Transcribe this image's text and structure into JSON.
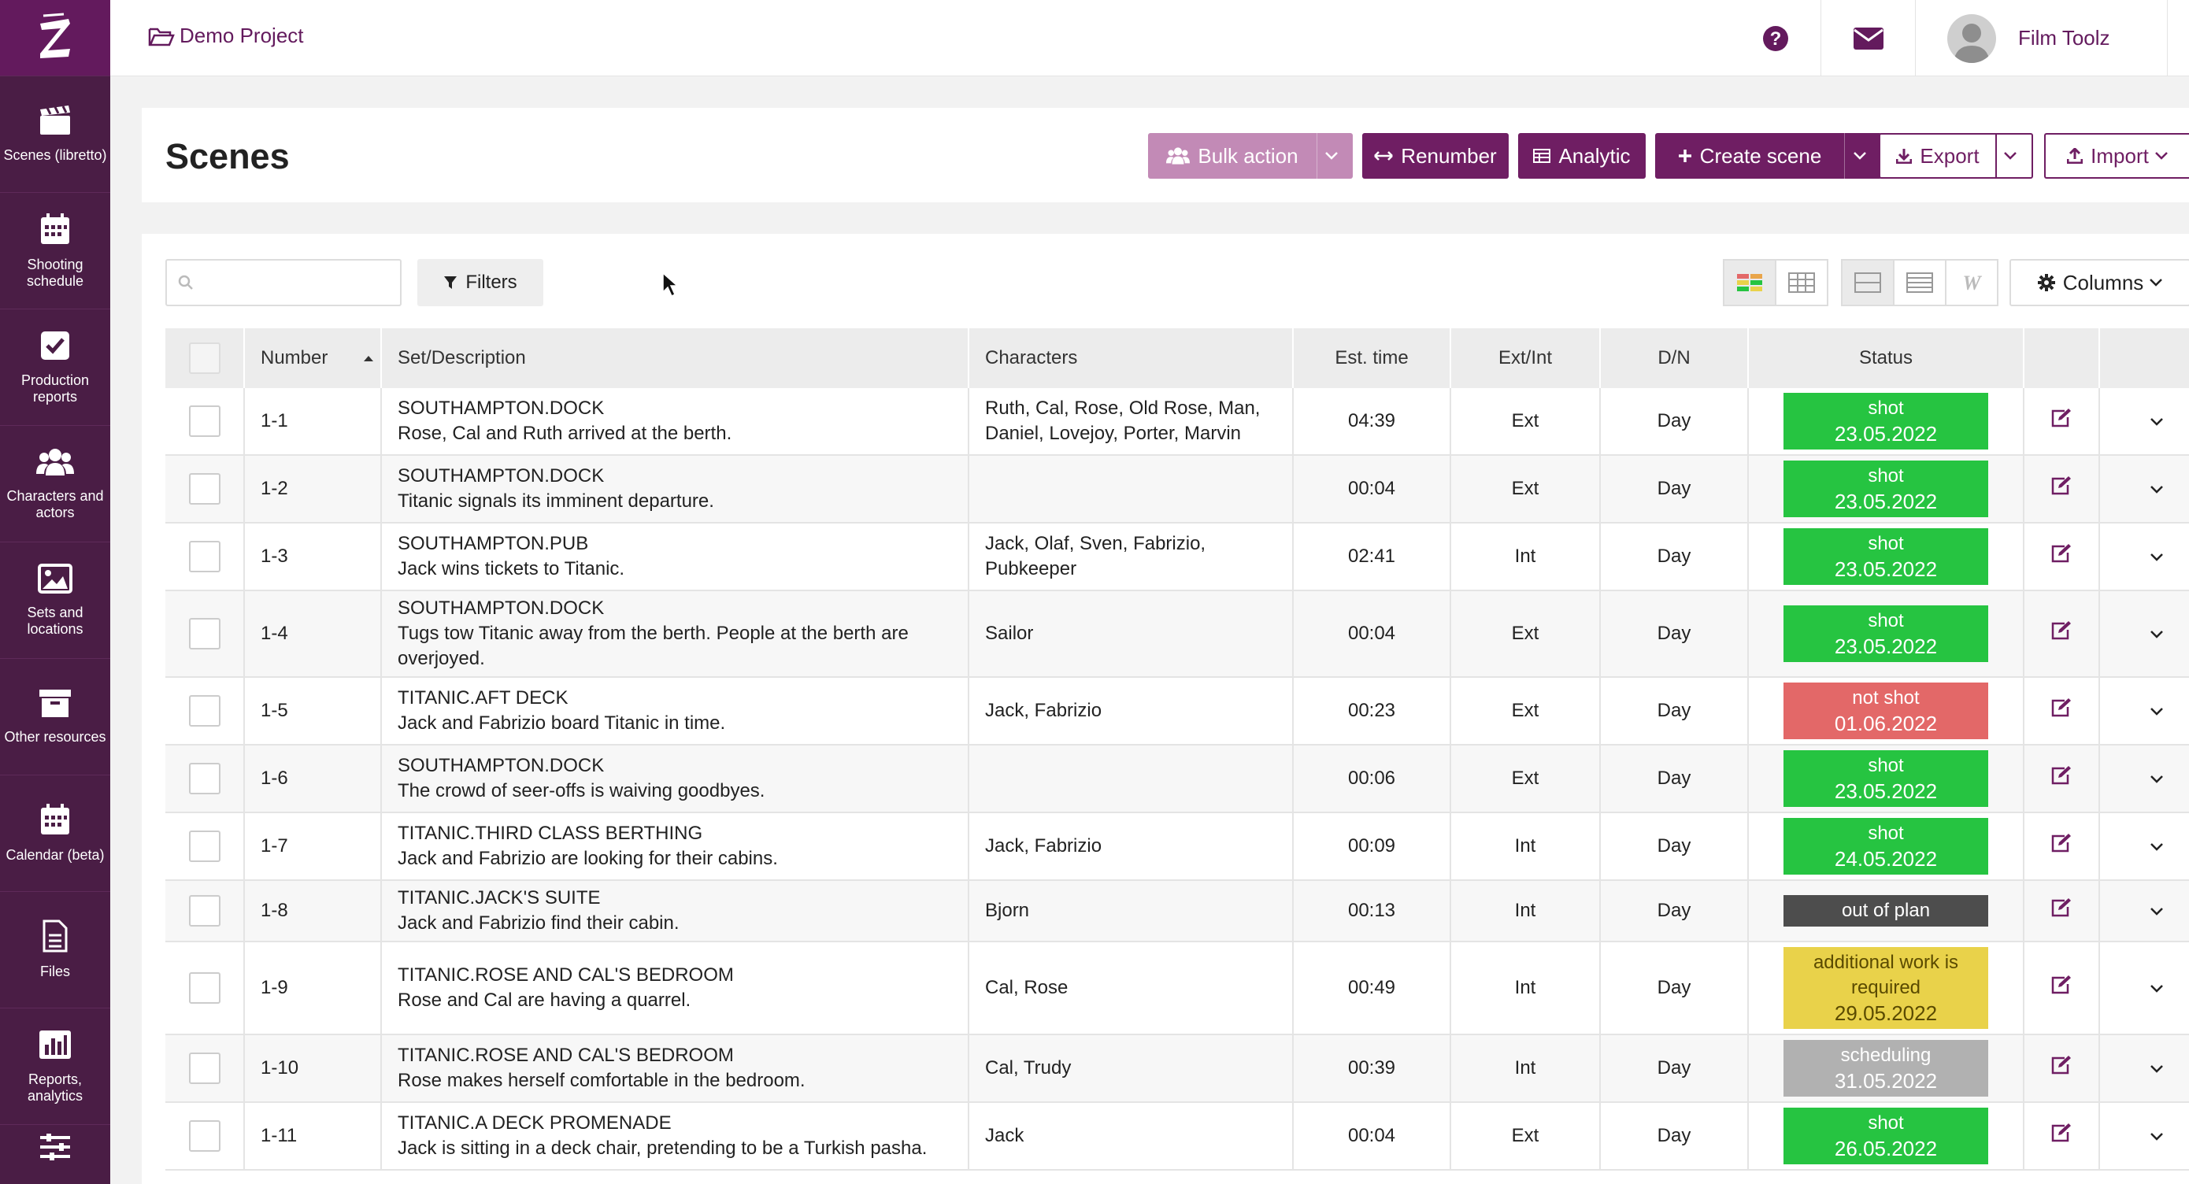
{
  "sidebar": {
    "logo": "Z",
    "items": [
      {
        "label": "Scenes (libretto)",
        "icon": "clapperboard-icon"
      },
      {
        "label": "Shooting schedule",
        "icon": "calendar-icon"
      },
      {
        "label": "Production reports",
        "icon": "checkbox-icon"
      },
      {
        "label": "Characters and actors",
        "icon": "users-icon"
      },
      {
        "label": "Sets and locations",
        "icon": "image-icon"
      },
      {
        "label": "Other resources",
        "icon": "archive-icon"
      },
      {
        "label": "Calendar (beta)",
        "icon": "calendar-icon"
      },
      {
        "label": "Files",
        "icon": "file-icon"
      },
      {
        "label": "Reports, analytics",
        "icon": "bar-chart-icon"
      },
      {
        "label": "",
        "icon": "sliders-icon"
      }
    ]
  },
  "topbar": {
    "project": "Demo Project",
    "user_name": "Film Toolz"
  },
  "header": {
    "title": "Scenes",
    "bulk_action": "Bulk action",
    "renumber": "Renumber",
    "analytic": "Analytic",
    "create_scene": "Create scene",
    "export": "Export",
    "import": "Import"
  },
  "toolbar": {
    "search_placeholder": "",
    "filters": "Filters",
    "columns": "Columns"
  },
  "table": {
    "headers": {
      "number": "Number",
      "set_description": "Set/Description",
      "characters": "Characters",
      "est_time": "Est. time",
      "ext_int": "Ext/Int",
      "dn": "D/N",
      "status": "Status"
    },
    "rows": [
      {
        "number": "1-1",
        "set": "SOUTHAMPTON.DOCK",
        "desc": "Rose, Cal and Ruth arrived at the berth.",
        "characters": "Ruth, Cal, Rose, Old Rose, Man, Daniel, Lovejoy, Porter, Marvin",
        "time": "04:39",
        "extint": "Ext",
        "dn": "Day",
        "status": "shot",
        "status_date": "23.05.2022",
        "status_kind": "shot"
      },
      {
        "number": "1-2",
        "set": "SOUTHAMPTON.DOCK",
        "desc": "Titanic signals its imminent departure.",
        "characters": "",
        "time": "00:04",
        "extint": "Ext",
        "dn": "Day",
        "status": "shot",
        "status_date": "23.05.2022",
        "status_kind": "shot"
      },
      {
        "number": "1-3",
        "set": "SOUTHAMPTON.PUB",
        "desc": "Jack wins tickets to Titanic.",
        "characters": "Jaсk, Olaf, Sven, Fabrizio, Pubkeeper",
        "time": "02:41",
        "extint": "Int",
        "dn": "Day",
        "status": "shot",
        "status_date": "23.05.2022",
        "status_kind": "shot"
      },
      {
        "number": "1-4",
        "set": "SOUTHAMPTON.DOCK",
        "desc": "Tugs tow Titanic away from the berth. People at the berth are overjoyed.",
        "characters": "Sailor",
        "time": "00:04",
        "extint": "Ext",
        "dn": "Day",
        "status": "shot",
        "status_date": "23.05.2022",
        "status_kind": "shot"
      },
      {
        "number": "1-5",
        "set": "TITANIC.AFT DECK",
        "desc": "Jack and Fabrizio board Titanic in time.",
        "characters": "Jaсk, Fabrizio",
        "time": "00:23",
        "extint": "Ext",
        "dn": "Day",
        "status": "not shot",
        "status_date": "01.06.2022",
        "status_kind": "notshot"
      },
      {
        "number": "1-6",
        "set": "SOUTHAMPTON.DOCK",
        "desc": "The crowd of seer-offs is waiving goodbyes.",
        "characters": "",
        "time": "00:06",
        "extint": "Ext",
        "dn": "Day",
        "status": "shot",
        "status_date": "23.05.2022",
        "status_kind": "shot"
      },
      {
        "number": "1-7",
        "set": "TITANIC.THIRD CLASS BERTHING",
        "desc": "Jack and Fabrizio are looking for their cabins.",
        "characters": "Jaсk, Fabrizio",
        "time": "00:09",
        "extint": "Int",
        "dn": "Day",
        "status": "shot",
        "status_date": "24.05.2022",
        "status_kind": "shot"
      },
      {
        "number": "1-8",
        "set": "TITANIC.JACK'S SUITE",
        "desc": "Jack and Fabrizio find their cabin.",
        "characters": "Bjorn",
        "time": "00:13",
        "extint": "Int",
        "dn": "Day",
        "status": "out of plan",
        "status_date": "",
        "status_kind": "out"
      },
      {
        "number": "1-9",
        "set": "TITANIC.ROSE AND CAL'S BEDROOM",
        "desc": "Rose and Cal are having a quarrel.",
        "characters": "Cal, Rose",
        "time": "00:49",
        "extint": "Int",
        "dn": "Day",
        "status": "additional work is required",
        "status_date": "29.05.2022",
        "status_kind": "add"
      },
      {
        "number": "1-10",
        "set": "TITANIC.ROSE AND CAL'S BEDROOM",
        "desc": "Rose makes herself comfortable in the bedroom.",
        "characters": "Cal, Trudy",
        "time": "00:39",
        "extint": "Int",
        "dn": "Day",
        "status": "scheduling",
        "status_date": "31.05.2022",
        "status_kind": "sched"
      },
      {
        "number": "1-11",
        "set": "TITANIC.A DECK PROMENADE",
        "desc": "Jack is sitting in a deck chair, pretending to be a Turkish pasha.",
        "characters": "Jaсk",
        "time": "00:04",
        "extint": "Ext",
        "dn": "Day",
        "status": "shot",
        "status_date": "26.05.2022",
        "status_kind": "shot"
      }
    ]
  },
  "colors": {
    "sidebar": "#4a1d45",
    "brand": "#6f1e63",
    "shot": "#26c441",
    "not_shot": "#e36868",
    "out_of_plan": "#4d4d4d",
    "additional": "#e9d24a",
    "scheduling": "#b1b1b1"
  }
}
